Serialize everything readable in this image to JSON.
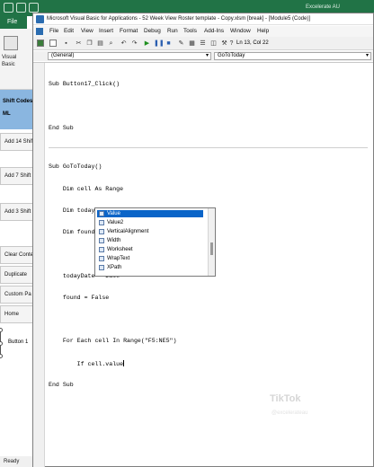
{
  "excel": {
    "window_title_right": "Excelerate AU",
    "file_tab": "File",
    "ribbon_visual_basic": "Visual Basic",
    "shift_codes": "Shift Codes",
    "ml": "ML",
    "buttons": [
      "Add 14 Shif",
      "Add 7 Shift",
      "Add 3 Shift",
      "Clear Conte",
      "Duplicate",
      "Custom Pa",
      "Home"
    ],
    "selected_button_label": "Button 1",
    "status": "Ready"
  },
  "vba": {
    "title": "Microsoft Visual Basic for Applications - 52 Week View Roster template - Copy.xlsm [break] - [Module5 (Code)]",
    "menu": [
      "File",
      "Edit",
      "View",
      "Insert",
      "Format",
      "Debug",
      "Run",
      "Tools",
      "Add-Ins",
      "Window",
      "Help"
    ],
    "cursor_position": "Ln 13, Col 22",
    "object_combo": "(General)",
    "procedure_combo": "GoToToday",
    "code_lines_before": [
      "Sub Button17_Click()",
      "",
      "End Sub"
    ],
    "code_lines_main": [
      "Sub GoToToday()",
      "    Dim cell As Range",
      "    Dim todayDate As Date",
      "    Dim found As Boolean",
      "",
      "    todayDate = Date",
      "    found = False",
      "",
      "    For Each cell In Range(\"F5:NE5\")",
      "        If cell.value",
      "End Sub"
    ],
    "intellisense": {
      "items": [
        "Value",
        "Value2",
        "VerticalAlignment",
        "Width",
        "Worksheet",
        "WrapText",
        "XPath"
      ],
      "selected": "Value"
    }
  },
  "watermark": {
    "brand": "TikTok",
    "handle": "@excelerateau"
  }
}
